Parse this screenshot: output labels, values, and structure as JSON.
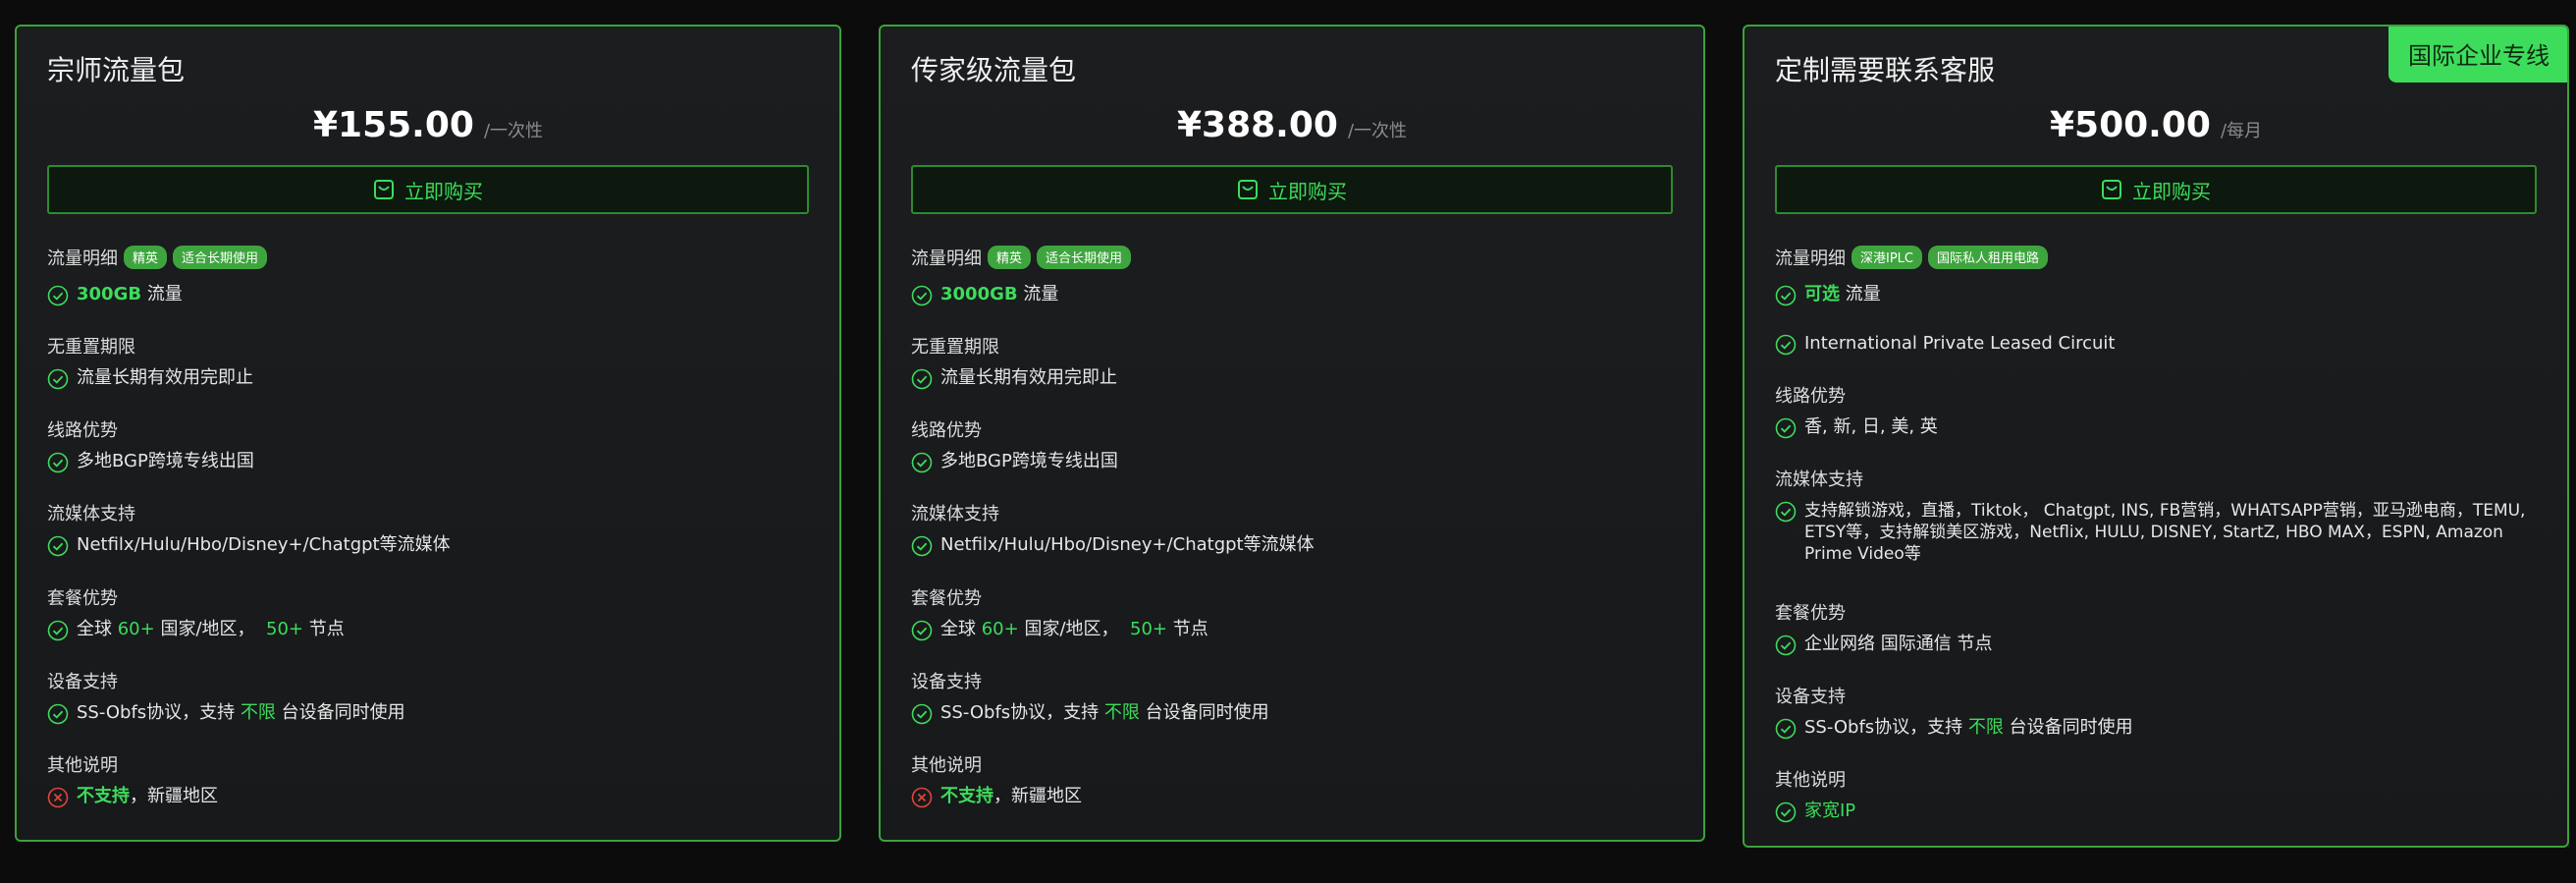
{
  "cards": [
    {
      "title": "宗师流量包",
      "price": "¥155.00",
      "period": "/一次性",
      "buy_label": "立即购买",
      "sections": [
        {
          "title": "流量明细",
          "badges": [
            "精英",
            "适合长期使用"
          ]
        },
        {
          "title": "无重置期限"
        },
        {
          "title": "线路优势"
        },
        {
          "title": "流媒体支持"
        },
        {
          "title": "套餐优势"
        },
        {
          "title": "设备支持"
        },
        {
          "title": "其他说明"
        }
      ],
      "items": {
        "traffic_value": "300GB",
        "traffic_unit": "流量",
        "reset": "流量长期有效用完即止",
        "route": "多地BGP跨境专线出国",
        "streaming": "Netfilx/Hulu/Hbo/Disney+/Chatgpt等流媒体",
        "package_a": "全球",
        "package_b": "60+",
        "package_c": "国家/地区，",
        "package_d": "50+",
        "package_e": "节点",
        "device_a": "SS-Obfs协议，支持",
        "device_b": "不限",
        "device_c": "台设备同时使用",
        "other_a": "不支持",
        "other_b": "，新疆地区"
      }
    },
    {
      "title": "传家级流量包",
      "price": "¥388.00",
      "period": "/一次性",
      "buy_label": "立即购买",
      "sections": [
        {
          "title": "流量明细",
          "badges": [
            "精英",
            "适合长期使用"
          ]
        },
        {
          "title": "无重置期限"
        },
        {
          "title": "线路优势"
        },
        {
          "title": "流媒体支持"
        },
        {
          "title": "套餐优势"
        },
        {
          "title": "设备支持"
        },
        {
          "title": "其他说明"
        }
      ],
      "items": {
        "traffic_value": "3000GB",
        "traffic_unit": "流量",
        "reset": "流量长期有效用完即止",
        "route": "多地BGP跨境专线出国",
        "streaming": "Netfilx/Hulu/Hbo/Disney+/Chatgpt等流媒体",
        "package_a": "全球",
        "package_b": "60+",
        "package_c": "国家/地区，",
        "package_d": "50+",
        "package_e": "节点",
        "device_a": "SS-Obfs协议，支持",
        "device_b": "不限",
        "device_c": "台设备同时使用",
        "other_a": "不支持",
        "other_b": "，新疆地区"
      }
    },
    {
      "ribbon": "国际企业专线",
      "title": "定制需要联系客服",
      "price": "¥500.00",
      "period": "/每月",
      "buy_label": "立即购买",
      "sections": [
        {
          "title": "流量明细",
          "badges": [
            "深港IPLC",
            "国际私人租用电路"
          ]
        },
        {
          "title": "线路优势"
        },
        {
          "title": "流媒体支持"
        },
        {
          "title": "套餐优势"
        },
        {
          "title": "设备支持"
        },
        {
          "title": "其他说明"
        }
      ],
      "items": {
        "traffic_value": "可选",
        "traffic_unit": "流量",
        "iplc": "International Private Leased Circuit",
        "route": "香, 新, 日, 美, 英",
        "streaming": "支持解锁游戏，直播，Tiktok， Chatgpt, INS, FB营销，WHATSAPP营销，亚马逊电商，TEMU, ETSY等，支持解锁美区游戏，Netflix, HULU, DISNEY, StartZ, HBO MAX，ESPN, Amazon Prime Video等",
        "package": "企业网络 国际通信 节点",
        "device_a": "SS-Obfs协议，支持",
        "device_b": "不限",
        "device_c": "台设备同时使用",
        "other": "家宽IP"
      }
    }
  ],
  "icons": {
    "check": "check-circle-icon",
    "cross": "x-circle-icon",
    "buy": "cart-box-icon"
  },
  "colors": {
    "accent": "#3ddc5a",
    "border": "#3aa33a",
    "error": "#e0443c",
    "background": "#0b0c0b"
  }
}
